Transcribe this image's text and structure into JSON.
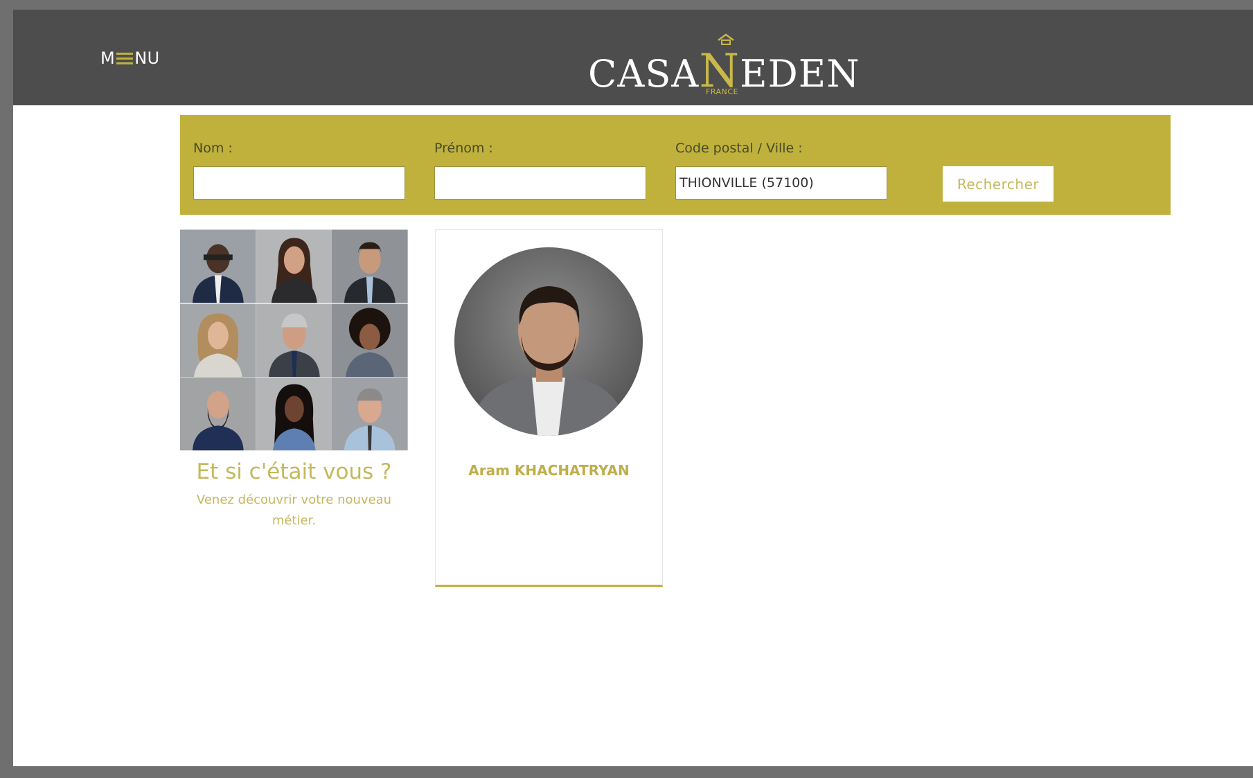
{
  "header": {
    "menu_label_left": "M",
    "menu_label_right": "NU",
    "menu_icon": "hamburger-icon",
    "logo": {
      "text_left": "CASA",
      "text_accent": "N",
      "text_right": "EDEN",
      "subtitle": "FRANCE"
    }
  },
  "search": {
    "nom_label": "Nom :",
    "nom_value": "",
    "prenom_label": "Prénom :",
    "prenom_value": "",
    "ville_label": "Code postal / Ville :",
    "ville_value": "THIONVILLE (57100)",
    "button_label": "Rechercher"
  },
  "promo": {
    "title": "Et si c'était vous ?",
    "subtitle_line1": "Venez découvrir votre nouveau",
    "subtitle_line2": "métier."
  },
  "results": [
    {
      "name": "Aram KHACHATRYAN"
    }
  ],
  "colors": {
    "header_bg": "#4d4d4d",
    "accent": "#bfb13c",
    "accent_text": "#c4b85b",
    "page_bg": "#ffffff"
  }
}
